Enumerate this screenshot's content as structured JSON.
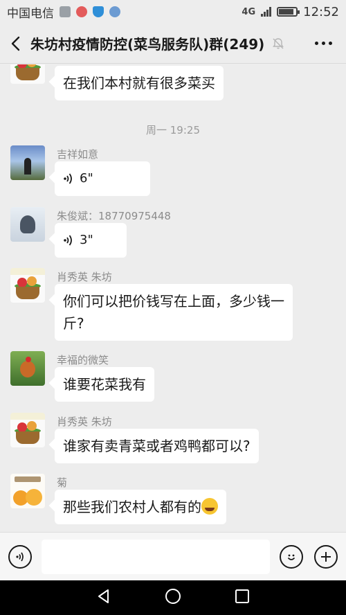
{
  "status_bar": {
    "carrier": "中国电信",
    "network": "4G",
    "network_small": "4G 2G",
    "time": "12:52"
  },
  "header": {
    "title": "朱坊村疫情防控(菜鸟服务队)群(249)"
  },
  "chat": {
    "top_message": {
      "text": "在我们本村就有很多菜买"
    },
    "timestamp": "周一 19:25",
    "messages": [
      {
        "sender": "吉祥如意",
        "type": "voice",
        "text": "6\""
      },
      {
        "sender": "朱俊斌：18770975448",
        "type": "voice",
        "text": "3\""
      },
      {
        "sender": "肖秀英 朱坊",
        "type": "text",
        "text": "你们可以把价钱写在上面，多少钱一斤?"
      },
      {
        "sender": "幸福的微笑",
        "type": "text",
        "text": "谁要花菜我有"
      },
      {
        "sender": "肖秀英 朱坊",
        "type": "text",
        "text": "谁家有卖青菜或者鸡鸭都可以?"
      },
      {
        "sender": "菊",
        "type": "text",
        "text": "那些我们农村人都有的"
      }
    ]
  },
  "input_bar": {
    "placeholder": ""
  },
  "colors": {
    "background": "#ededed",
    "bubble": "#ffffff",
    "nav_bar": "#000000"
  }
}
